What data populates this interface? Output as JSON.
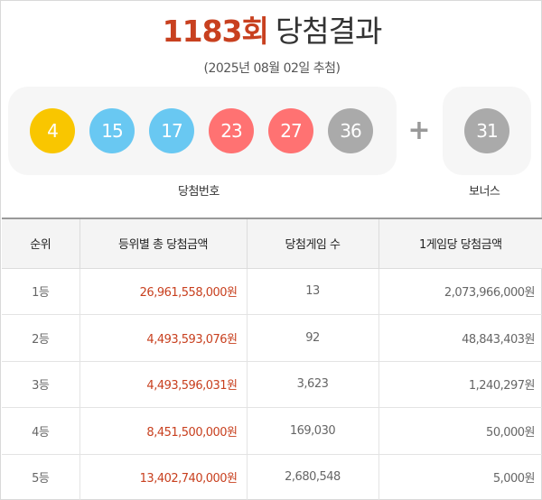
{
  "header": {
    "round": "1183회",
    "title": "당첨결과",
    "draw_date": "(2025년 08월 02일 추첨)"
  },
  "numbers": {
    "winning": [
      {
        "value": "4",
        "color": "#f9c600"
      },
      {
        "value": "15",
        "color": "#69c8f2"
      },
      {
        "value": "17",
        "color": "#69c8f2"
      },
      {
        "value": "23",
        "color": "#ff7272"
      },
      {
        "value": "27",
        "color": "#ff7272"
      },
      {
        "value": "36",
        "color": "#aaaaaa"
      }
    ],
    "plus_sign": "+",
    "bonus": {
      "value": "31",
      "color": "#aaaaaa"
    },
    "winning_caption": "당첨번호",
    "bonus_caption": "보너스"
  },
  "table": {
    "headers": [
      "순위",
      "등위별 총 당첨금액",
      "당첨게임 수",
      "1게임당 당첨금액"
    ],
    "rows": [
      {
        "rank": "1등",
        "total": "26,961,558,000원",
        "count": "13",
        "prize": "2,073,966,000원"
      },
      {
        "rank": "2등",
        "total": "4,493,593,076원",
        "count": "92",
        "prize": "48,843,403원"
      },
      {
        "rank": "3등",
        "total": "4,493,596,031원",
        "count": "3,623",
        "prize": "1,240,297원"
      },
      {
        "rank": "4등",
        "total": "8,451,500,000원",
        "count": "169,030",
        "prize": "50,000원"
      },
      {
        "rank": "5등",
        "total": "13,402,740,000원",
        "count": "2,680,548",
        "prize": "5,000원"
      }
    ]
  }
}
